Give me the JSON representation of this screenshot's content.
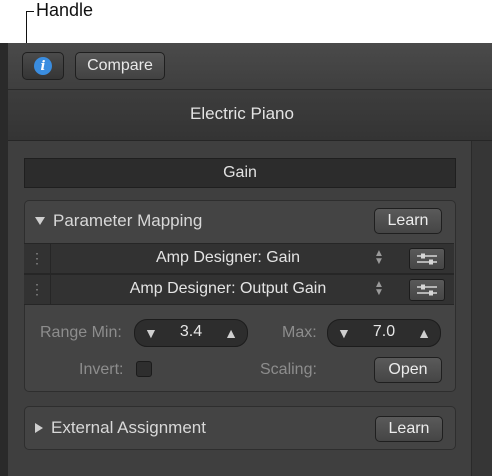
{
  "callout": {
    "label": "Handle"
  },
  "toolbar": {
    "compare_label": "Compare"
  },
  "plugin": {
    "title": "Electric Piano"
  },
  "section": {
    "title": "Gain"
  },
  "parameter_mapping": {
    "title": "Parameter Mapping",
    "learn_label": "Learn",
    "rows": [
      {
        "label": "Amp Designer: Gain"
      },
      {
        "label": "Amp Designer: Output Gain"
      }
    ],
    "range_min_label": "Range Min:",
    "range_min_value": "3.4",
    "max_label": "Max:",
    "max_value": "7.0",
    "invert_label": "Invert:",
    "scaling_label": "Scaling:",
    "open_label": "Open"
  },
  "external_assignment": {
    "title": "External Assignment",
    "learn_label": "Learn"
  },
  "colors": {
    "accent": "#3a8de0",
    "panel": "#444444",
    "background": "#3b3b3b"
  }
}
